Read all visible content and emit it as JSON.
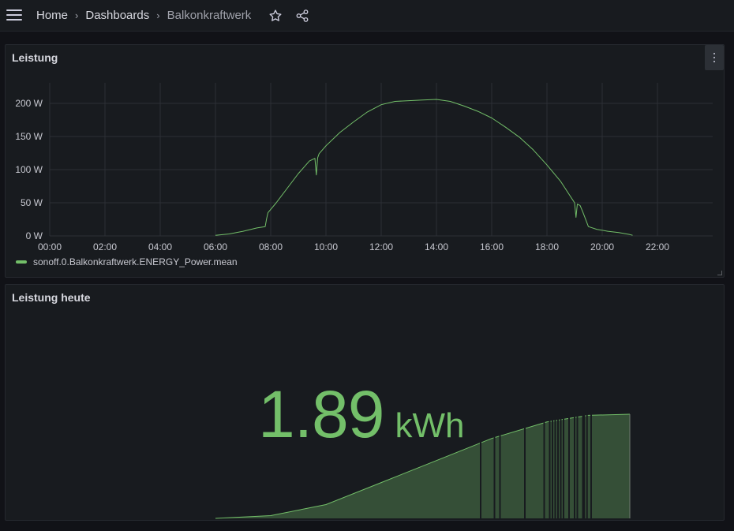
{
  "nav": {
    "breadcrumbs": [
      "Home",
      "Dashboards",
      "Balkonkraftwerk"
    ],
    "separator": "›"
  },
  "colors": {
    "series": "#73bf69",
    "grid": "#2c2f35",
    "panel_bg": "#181b1f"
  },
  "icons": {
    "menu": "menu-icon",
    "star": "star-icon",
    "share": "share-icon",
    "panel_menu": "kebab-icon"
  },
  "panels": {
    "power": {
      "title": "Leistung",
      "legend": "sonoff.0.Balkonkraftwerk.ENERGY_Power.mean",
      "chart_data": {
        "type": "line",
        "title": "Leistung",
        "xlabel": "",
        "ylabel": "",
        "x_ticks": [
          "00:00",
          "02:00",
          "04:00",
          "06:00",
          "08:00",
          "10:00",
          "12:00",
          "14:00",
          "16:00",
          "18:00",
          "20:00",
          "22:00"
        ],
        "y_ticks": [
          "0 W",
          "50 W",
          "100 W",
          "150 W",
          "200 W"
        ],
        "xlim": [
          0,
          24
        ],
        "ylim": [
          0,
          200
        ],
        "grid": true,
        "legend_position": "bottom-left",
        "series": [
          {
            "name": "sonoff.0.Balkonkraftwerk.ENERGY_Power.mean",
            "x": [
              6.0,
              6.5,
              7.0,
              7.5,
              7.8,
              7.85,
              7.9,
              8.2,
              8.6,
              9.0,
              9.4,
              9.6,
              9.65,
              9.7,
              9.75,
              10.0,
              10.5,
              11.0,
              11.5,
              12.0,
              12.5,
              13.0,
              13.5,
              14.0,
              14.5,
              15.0,
              15.5,
              16.0,
              16.5,
              17.0,
              17.5,
              18.0,
              18.5,
              19.0,
              19.05,
              19.1,
              19.2,
              19.3,
              19.5,
              19.8,
              20.2,
              20.6,
              21.0,
              21.1
            ],
            "y": [
              1,
              3,
              7,
              12,
              14,
              26,
              35,
              50,
              72,
              94,
              113,
              117,
              92,
              118,
              124,
              136,
              156,
              172,
              187,
              198,
              203,
              204,
              205,
              206,
              203,
              196,
              188,
              178,
              164,
              149,
              130,
              107,
              82,
              50,
              28,
              48,
              46,
              36,
              14,
              10,
              7,
              5,
              2,
              1
            ]
          }
        ]
      }
    },
    "today": {
      "title": "Leistung heute",
      "value": "1.89",
      "unit": "kWh",
      "sparkline_data": {
        "type": "area",
        "x_range": [
          "06:00",
          "21:00"
        ],
        "x": [
          6,
          8,
          10,
          12,
          14,
          16,
          18,
          19.5,
          21
        ],
        "y": [
          0.0,
          0.05,
          0.25,
          0.65,
          1.05,
          1.45,
          1.75,
          1.87,
          1.89
        ]
      }
    }
  }
}
